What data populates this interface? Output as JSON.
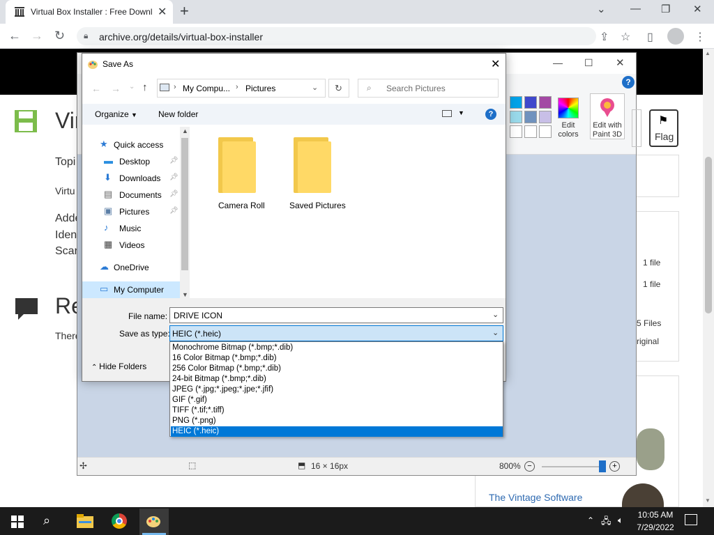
{
  "browser": {
    "tab_title": "Virtual Box Installer : Free Downl",
    "url": "archive.org/details/virtual-box-installer"
  },
  "page": {
    "title_partial": "Vir",
    "topics_partial": "Topi",
    "line1": "Virtu",
    "line2": "Adde",
    "line3": "Iden",
    "line4": "Scar",
    "reviews_partial": "Re",
    "there_partial": "There",
    "flag_label": "Flag",
    "file_count_1": "1 file",
    "file_count_2": "1 file",
    "files_label": "5 Files",
    "original_label": "riginal",
    "vintage_link": "The Vintage Software"
  },
  "paint": {
    "edit_colors": "Edit colors",
    "edit_paint3d": "Edit with Paint 3D",
    "size_label": "16 × 16px",
    "zoom": "800%",
    "zoom_level_percent": 800,
    "swatch_colors": [
      "#00a2e8",
      "#3f48cc",
      "#a349a4",
      "#99d9ea",
      "#7092be",
      "#c8bfe7",
      "#ffffff",
      "#ffffff",
      "#ffffff"
    ]
  },
  "dialog": {
    "title": "Save As",
    "breadcrumb": [
      "My Compu...",
      "Pictures"
    ],
    "search_placeholder": "Search Pictures",
    "organize": "Organize",
    "new_folder": "New folder",
    "nav_items": [
      {
        "label": "Quick access",
        "icon": "star-icon",
        "pinned": false
      },
      {
        "label": "Desktop",
        "icon": "desktop-icon",
        "pinned": true
      },
      {
        "label": "Downloads",
        "icon": "download-icon",
        "pinned": true
      },
      {
        "label": "Documents",
        "icon": "document-icon",
        "pinned": true
      },
      {
        "label": "Pictures",
        "icon": "pictures-icon",
        "pinned": true
      },
      {
        "label": "Music",
        "icon": "music-icon",
        "pinned": false
      },
      {
        "label": "Videos",
        "icon": "video-icon",
        "pinned": false
      },
      {
        "label": "OneDrive",
        "icon": "cloud-icon",
        "pinned": false
      },
      {
        "label": "My Computer",
        "icon": "computer-icon",
        "pinned": false
      }
    ],
    "folders": [
      "Camera Roll",
      "Saved Pictures"
    ],
    "file_name_label": "File name:",
    "file_name_value": "DRIVE ICON",
    "save_type_label": "Save as type:",
    "save_type_value": "HEIC (*.heic)",
    "hide_folders": "Hide Folders",
    "type_options": [
      "Monochrome Bitmap (*.bmp;*.dib)",
      "16 Color Bitmap (*.bmp;*.dib)",
      "256 Color Bitmap (*.bmp;*.dib)",
      "24-bit Bitmap (*.bmp;*.dib)",
      "JPEG (*.jpg;*.jpeg;*.jpe;*.jfif)",
      "GIF (*.gif)",
      "TIFF (*.tif;*.tiff)",
      "PNG (*.png)",
      "HEIC (*.heic)"
    ],
    "selected_option": "HEIC (*.heic)"
  },
  "taskbar": {
    "time": "10:05 AM",
    "date": "7/29/2022"
  }
}
